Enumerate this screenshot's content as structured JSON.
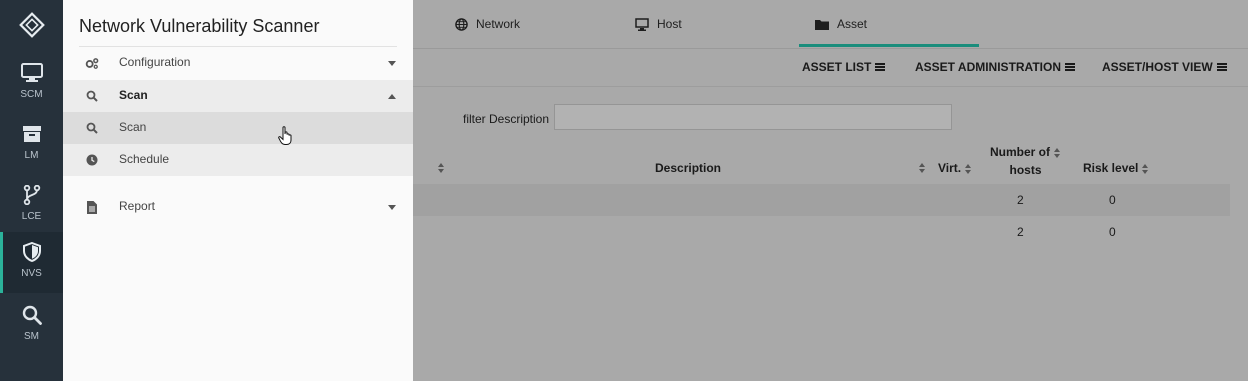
{
  "app": {
    "title": "Network Vulnerability Scanner"
  },
  "rail": {
    "items": [
      {
        "label": "SCM",
        "icon": "monitor-icon"
      },
      {
        "label": "LM",
        "icon": "archive-icon"
      },
      {
        "label": "LCE",
        "icon": "branch-icon"
      },
      {
        "label": "NVS",
        "icon": "shield-icon",
        "active": true
      },
      {
        "label": "SM",
        "icon": "search-icon"
      }
    ]
  },
  "drawer": {
    "menu": [
      {
        "label": "Configuration",
        "icon": "gears-icon",
        "expanded": false
      },
      {
        "label": "Scan",
        "icon": "search-icon",
        "expanded": true
      },
      {
        "label": "Scan",
        "icon": "search-icon",
        "selected": true
      },
      {
        "label": "Schedule",
        "icon": "clock-icon"
      },
      {
        "label": "Report",
        "icon": "document-icon",
        "expanded": false
      }
    ]
  },
  "tabs": [
    {
      "label": "Network",
      "icon": "globe-icon"
    },
    {
      "label": "Host",
      "icon": "monitor-icon"
    },
    {
      "label": "Asset",
      "icon": "folder-icon",
      "active": true
    }
  ],
  "toolbar": {
    "asset_list": "ASSET LIST",
    "asset_administration": "ASSET ADMINISTRATION",
    "asset_host_view": "ASSET/HOST VIEW"
  },
  "filter": {
    "label": "filter Description",
    "value": ""
  },
  "table": {
    "headers": {
      "description": "Description",
      "virt": "Virt.",
      "hosts_line1": "Number of",
      "hosts_line2": "hosts",
      "risk": "Risk level"
    },
    "rows": [
      {
        "hosts": "2",
        "risk": "0"
      },
      {
        "hosts": "2",
        "risk": "0"
      }
    ]
  },
  "colors": {
    "accent": "#2bb29a",
    "rail": "#26313b",
    "overlay": "#a9a9a9"
  }
}
